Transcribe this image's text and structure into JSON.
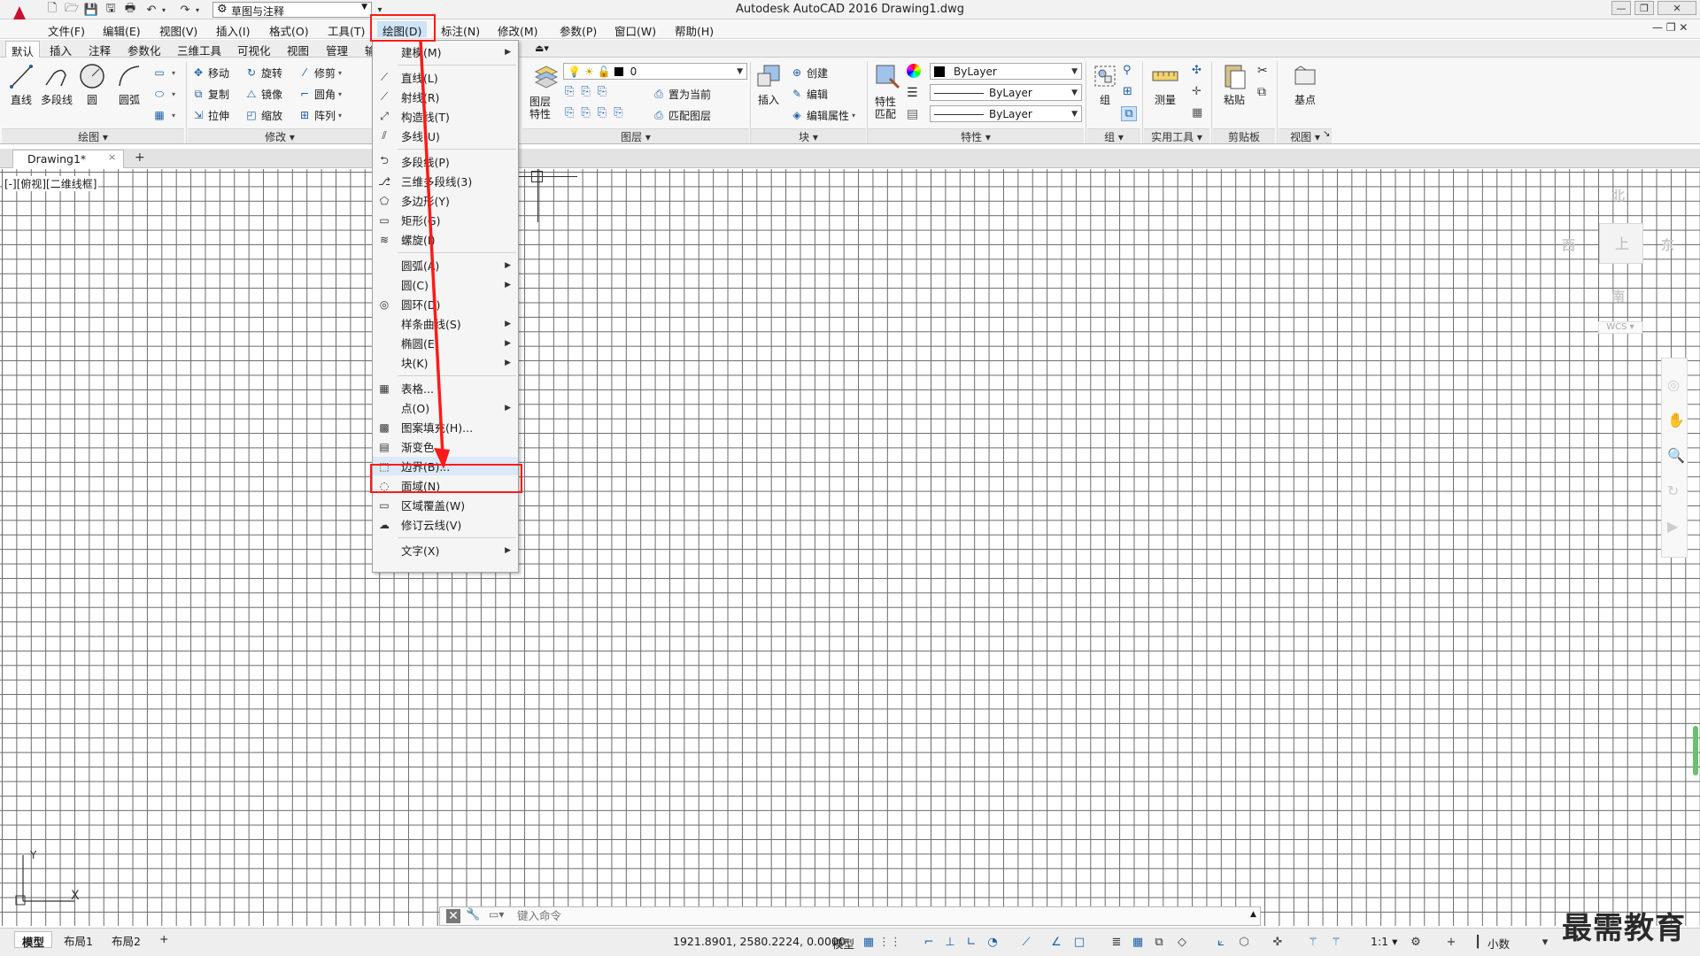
{
  "window": {
    "title": "Autodesk AutoCAD 2016    Drawing1.dwg",
    "workspace": "草图与注释",
    "controls": [
      "—",
      "❐",
      "✕"
    ],
    "doc_controls": "— ❐ ✕"
  },
  "menubar": {
    "items": [
      "文件(F)",
      "编辑(E)",
      "视图(V)",
      "插入(I)",
      "格式(O)",
      "工具(T)",
      "绘图(D)",
      "标注(N)",
      "修改(M)",
      "参数(P)",
      "窗口(W)",
      "帮助(H)"
    ],
    "active": "绘图(D)"
  },
  "ribbon_tabs": [
    "默认",
    "插入",
    "注释",
    "参数化",
    "三维工具",
    "可视化",
    "视图",
    "管理",
    "输"
  ],
  "ribbon": {
    "draw_panel": {
      "title": "绘图 ▾",
      "big_tools": [
        "直线",
        "多段线",
        "圆",
        "圆弧"
      ]
    },
    "modify_panel": {
      "title": "修改 ▾",
      "rows": [
        [
          "移动",
          "旋转",
          "修剪"
        ],
        [
          "复制",
          "镜像",
          "圆角"
        ],
        [
          "拉伸",
          "缩放",
          "阵列"
        ]
      ]
    },
    "layer_panel": {
      "title": "图层 ▾",
      "big_tool": "图层\n特性",
      "layer_value": "0",
      "buttons": [
        "置为当前",
        "匹配图层"
      ]
    },
    "block_panel": {
      "title": "块 ▾",
      "big_tool": "插入",
      "buttons": [
        "创建",
        "编辑",
        "编辑属性"
      ]
    },
    "properties_panel": {
      "title": "特性 ▾",
      "big_tool": "特性\n匹配",
      "color": "ByLayer",
      "linetype": "ByLayer",
      "lineweight": "ByLayer"
    },
    "group_panel": {
      "title": "组 ▾",
      "big_tool": "组"
    },
    "utilities_panel": {
      "title": "实用工具 ▾",
      "big_tool": "测量"
    },
    "clipboard_panel": {
      "title": "剪贴板",
      "big_tool": "粘贴"
    },
    "view_panel": {
      "title": "视图 ▾",
      "big_tool": "基点"
    }
  },
  "document_tab": {
    "label": "Drawing1*",
    "close": "×",
    "add": "+"
  },
  "viewport_label": "[-][俯视][二维线框]",
  "viewcube": {
    "north": "北",
    "south": "南",
    "east": "东",
    "west": "西",
    "top": "上",
    "wcs": "WCS ▾"
  },
  "draw_menu": {
    "items": [
      {
        "label": "建模(M)",
        "icon": "modeling-icon",
        "submenu": true
      },
      {
        "sep": true
      },
      {
        "label": "直线(L)",
        "icon": "line-icon"
      },
      {
        "label": "射线(R)",
        "icon": "ray-icon"
      },
      {
        "label": "构造线(T)",
        "icon": "xline-icon"
      },
      {
        "label": "多线(U)",
        "icon": "mline-icon"
      },
      {
        "sep": true
      },
      {
        "label": "多段线(P)",
        "icon": "polyline-icon"
      },
      {
        "label": "三维多段线(3)",
        "icon": "3dpolyline-icon"
      },
      {
        "label": "多边形(Y)",
        "icon": "polygon-icon"
      },
      {
        "label": "矩形(G)",
        "icon": "rectangle-icon"
      },
      {
        "label": "螺旋(I)",
        "icon": "helix-icon"
      },
      {
        "sep": true
      },
      {
        "label": "圆弧(A)",
        "icon": "arc-icon",
        "submenu": true
      },
      {
        "label": "圆(C)",
        "icon": "circle-icon",
        "submenu": true
      },
      {
        "label": "圆环(D)",
        "icon": "donut-icon"
      },
      {
        "label": "样条曲线(S)",
        "icon": "spline-icon",
        "submenu": true
      },
      {
        "label": "椭圆(E)",
        "icon": "ellipse-icon",
        "submenu": true
      },
      {
        "label": "块(K)",
        "icon": "block-icon",
        "submenu": true
      },
      {
        "sep": true
      },
      {
        "label": "表格...",
        "icon": "table-icon"
      },
      {
        "label": "点(O)",
        "icon": "point-icon",
        "submenu": true
      },
      {
        "label": "图案填充(H)...",
        "icon": "hatch-icon"
      },
      {
        "label": "渐变色...",
        "icon": "gradient-icon"
      },
      {
        "label": "边界(B)...",
        "icon": "boundary-icon",
        "highlight": true
      },
      {
        "label": "面域(N)",
        "icon": "region-icon"
      },
      {
        "label": "区域覆盖(W)",
        "icon": "wipeout-icon"
      },
      {
        "label": "修订云线(V)",
        "icon": "revcloud-icon"
      },
      {
        "sep": true
      },
      {
        "label": "文字(X)",
        "icon": "text-icon",
        "submenu": true
      }
    ]
  },
  "command_line": {
    "placeholder": "键入命令"
  },
  "layout_tabs": [
    "模型",
    "布局1",
    "布局2",
    "+"
  ],
  "statusbar": {
    "coords": "1921.8901, 2580.2224, 0.0000",
    "model": "模型",
    "scale": "1:1 ▾",
    "units": "小数"
  },
  "watermark": "最需教育",
  "colors": {
    "highlight": "#ff1a1a",
    "accent": "#1d5fa8",
    "logo": "#c8102e"
  }
}
